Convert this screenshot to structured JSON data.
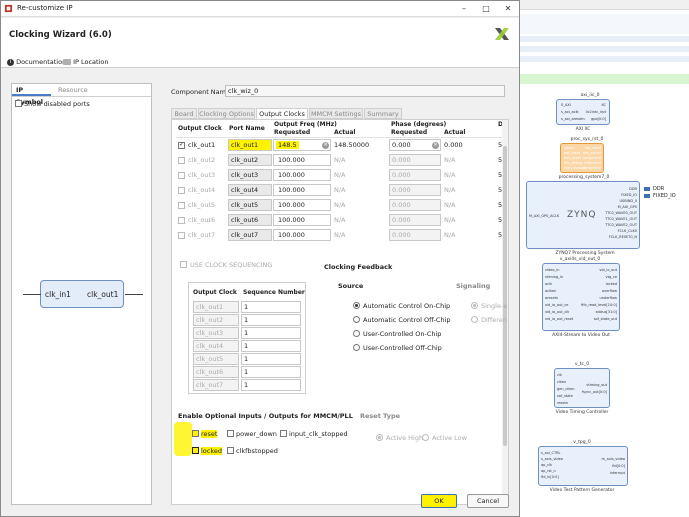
{
  "window": {
    "title": "Re-customize IP",
    "minimize": "–",
    "maximize": "□",
    "close": "✕"
  },
  "header": {
    "title": "Clocking Wizard (6.0)",
    "documentation": "Documentation",
    "ip_location": "IP Location"
  },
  "left_pane": {
    "tabs": [
      "IP Symbol",
      "Resource"
    ],
    "show_disabled_ports": "Show disabled ports",
    "symbol": {
      "input": "clk_in1",
      "output": "clk_out1"
    }
  },
  "component": {
    "label": "Component Name",
    "value": "clk_wiz_0"
  },
  "tabs": [
    "Board",
    "Clocking Options",
    "Output Clocks",
    "MMCM Settings",
    "Summary"
  ],
  "clocks_table": {
    "headers": {
      "output_clock": "Output Clock",
      "port_name": "Port Name",
      "freq_group": "Output Freq (MHz)",
      "phase_group": "Phase (degrees)",
      "requested": "Requested",
      "actual": "Actual",
      "duty": "D"
    },
    "rows": [
      {
        "name": "clk_out1",
        "port": "clk_out1",
        "freq_req": "148.5",
        "freq_act": "148.50000",
        "phase_req": "0.000",
        "phase_act": "0.000",
        "duty": "5",
        "checked": true
      },
      {
        "name": "clk_out2",
        "port": "clk_out2",
        "freq_req": "100.000",
        "freq_act": "N/A",
        "phase_req": "0.000",
        "phase_act": "N/A",
        "duty": "5",
        "checked": false
      },
      {
        "name": "clk_out3",
        "port": "clk_out3",
        "freq_req": "100.000",
        "freq_act": "N/A",
        "phase_req": "0.000",
        "phase_act": "N/A",
        "duty": "5",
        "checked": false
      },
      {
        "name": "clk_out4",
        "port": "clk_out4",
        "freq_req": "100.000",
        "freq_act": "N/A",
        "phase_req": "0.000",
        "phase_act": "N/A",
        "duty": "5",
        "checked": false
      },
      {
        "name": "clk_out5",
        "port": "clk_out5",
        "freq_req": "100.000",
        "freq_act": "N/A",
        "phase_req": "0.000",
        "phase_act": "N/A",
        "duty": "5",
        "checked": false
      },
      {
        "name": "clk_out6",
        "port": "clk_out6",
        "freq_req": "100.000",
        "freq_act": "N/A",
        "phase_req": "0.000",
        "phase_act": "N/A",
        "duty": "5",
        "checked": false
      },
      {
        "name": "clk_out7",
        "port": "clk_out7",
        "freq_req": "100.000",
        "freq_act": "N/A",
        "phase_req": "0.000",
        "phase_act": "N/A",
        "duty": "5",
        "checked": false
      }
    ]
  },
  "clock_sequencing": {
    "label": "USE CLOCK SEQUENCING",
    "headers": [
      "Output Clock",
      "Sequence Number"
    ],
    "rows": [
      {
        "clock": "clk_out1",
        "seq": "1"
      },
      {
        "clock": "clk_out2",
        "seq": "1"
      },
      {
        "clock": "clk_out3",
        "seq": "1"
      },
      {
        "clock": "clk_out4",
        "seq": "1"
      },
      {
        "clock": "clk_out5",
        "seq": "1"
      },
      {
        "clock": "clk_out6",
        "seq": "1"
      },
      {
        "clock": "clk_out7",
        "seq": "1"
      }
    ]
  },
  "clocking_feedback": {
    "title": "Clocking Feedback",
    "source_label": "Source",
    "signaling_label": "Signaling",
    "source_options": [
      "Automatic Control On-Chip",
      "Automatic Control Off-Chip",
      "User-Controlled On-Chip",
      "User-Controlled Off-Chip"
    ],
    "signaling_options": [
      "Single-e",
      "Differen"
    ]
  },
  "optional_io": {
    "title": "Enable Optional Inputs / Outputs for MMCM/PLL",
    "options": [
      "reset",
      "power_down",
      "input_clk_stopped",
      "locked",
      "clkfbstopped"
    ]
  },
  "reset_type": {
    "title": "Reset Type",
    "options": [
      "Active High",
      "Active Low"
    ]
  },
  "buttons": {
    "ok": "OK",
    "cancel": "Cancel"
  },
  "block_design": {
    "blocks": [
      {
        "title": "axi_iic_0",
        "caption": "AXI IIC",
        "pins_left": [
          "S_AXI",
          "s_axi_aclk",
          "s_axi_aresetn"
        ],
        "pins_right": [
          "IIC",
          "iic2intc_irpt",
          "gpo[0:0]"
        ]
      },
      {
        "title": "proc_sys_rst_0",
        "caption": "processing_system7_0",
        "pins_left": [
          "slowe",
          "ext_reset",
          "aux_reset",
          "mb_debug",
          "dcm_locked"
        ],
        "pins_right": [
          "mb_reset",
          "bus_struct",
          "peripheral",
          "interconn",
          "peripheral"
        ]
      },
      {
        "title": "processing_system7_0",
        "caption": "ZYNQ7 Processing System",
        "logo": "ZYNQ",
        "pins_left": [
          "M_AXI_GP0_ACLK"
        ],
        "pins_right": [
          "DDR",
          "FIXED_IO",
          "USBIND_0",
          "M_AXI_GP0",
          "TTC0_WAVE0_OUT",
          "TTC0_WAVE1_OUT",
          "TTC0_WAVE2_OUT",
          "FCLK_CLK0",
          "FCLK_RESET0_N"
        ]
      },
      {
        "title": "v_axi4s_vid_out_0",
        "caption": "AXI4-Stream to Video Out",
        "pins_left": [
          "video_in",
          "vtiming_in",
          "aclk",
          "aclken",
          "aresetn",
          "vid_io_out_ce",
          "vid_io_out_clk",
          "vid_io_out_reset"
        ],
        "pins_right": [
          "vid_io_out",
          "vtg_ce",
          "locked",
          "overflow",
          "underflow",
          "fifo_read_level[10:0]",
          "status[31:0]",
          "sof_state_out"
        ]
      },
      {
        "title": "v_tc_0",
        "caption": "Video Timing Controller",
        "pins_left": [
          "clk",
          "clken",
          "gen_clken",
          "sof_state",
          "resetn"
        ],
        "pins_right": [
          "vtiming_out",
          "fsync_out[0:0]"
        ]
      },
      {
        "title": "v_tpg_0",
        "caption": "Video Test Pattern Generator",
        "pins_left": [
          "s_axi_CTRL",
          "s_axis_video",
          "ap_clk",
          "ap_rst_n",
          "fid_in[0:0]"
        ],
        "pins_right": [
          "m_axis_video",
          "fid[0:0]",
          "interrupt"
        ]
      }
    ],
    "ports": [
      "DDR",
      "FIXED_IO"
    ]
  },
  "colors": {
    "highlight": "#fff200",
    "accent": "#4a7dc9",
    "ip_block": "#e8f0fb",
    "ip_block_orange": "#fbd7a8",
    "green_band": "#d8f5d2"
  }
}
